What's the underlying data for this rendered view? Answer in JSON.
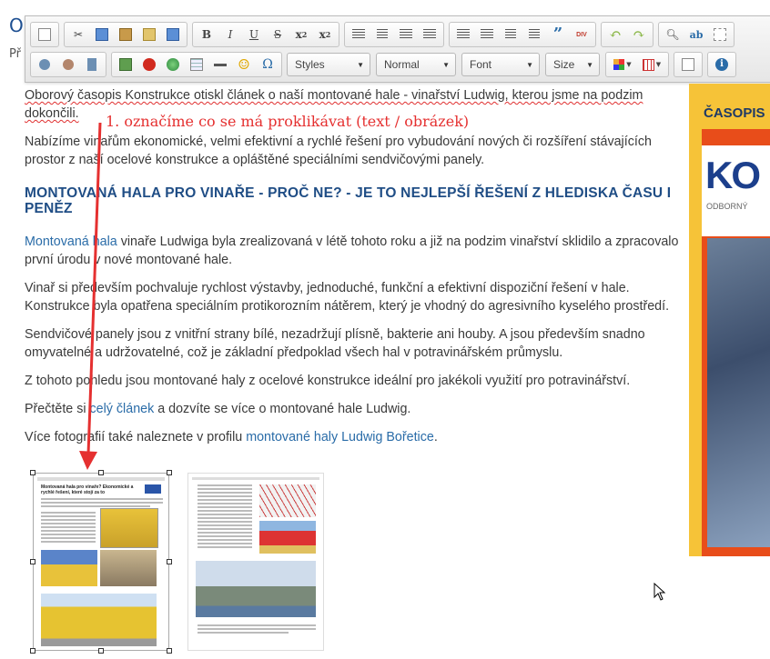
{
  "page": {
    "title_fragment": "O",
    "sub_fragment": "Př"
  },
  "toolbar": {
    "dropdowns": [
      {
        "id": "styles",
        "label": "Styles"
      },
      {
        "id": "format",
        "label": "Normal"
      },
      {
        "id": "font",
        "label": "Font"
      },
      {
        "id": "size",
        "label": "Size"
      }
    ],
    "labels": {
      "bold": "B",
      "italic": "I",
      "underline": "U",
      "strike": "S",
      "subscript": "x",
      "superscript": "x",
      "sub_index": "2",
      "sup_index": "2",
      "quote": "”",
      "div": "DIV",
      "smiley": "☺",
      "omega": "Ω",
      "info": "i"
    }
  },
  "annotation": "1. označíme co se má proklikávat (text / obrázek)",
  "content": {
    "p1": "Oborový časopis Konstrukce otiskl článek o naší montované hale - vinařství Ludwig, kterou jsme na podzim dokončili.",
    "p2": "Nabízíme vinařům ekonomické, velmi efektivní a rychlé řešení pro vybudování nových či rozšíření stávajících prostor z naší ocelové konstrukce a opláštěné speciálními sendvičovými panely.",
    "heading": "MONTOVANÁ HALA PRO VINAŘE - PROČ NE? - JE TO NEJLEPŠÍ ŘEŠENÍ Z HLEDISKA ČASU I PENĚZ",
    "p3_link": "Montovaná hala",
    "p3_rest": " vinaře Ludwiga byla zrealizovaná v létě tohoto roku a již na podzim vinařství sklidilo a zpracovalo první úrodu v nové montované hale.",
    "p4": "Vinař si především pochvaluje rychlost výstavby, jednoduché, funkční a efektivní dispoziční řešení v hale. Konstrukce byla opatřena speciálním protikorozním nátěrem, který je vhodný do agresivního kyselého prostředí.",
    "p5": "Sendvičové panely jsou z vnitřní strany bílé, nezadržují plísně, bakterie ani houby. A jsou především snadno omyvatelné a udržovatelné, což je základní předpoklad všech hal v potravinářském průmyslu.",
    "p6": "Z tohoto pohledu jsou montované haly z ocelové konstrukce ideální pro jakékoli využití pro potravinářství.",
    "p7_pre": "Přečtěte si ",
    "p7_link": "celý článek",
    "p7_post": " a dozvíte se více o montované hale Ludwig.",
    "p8_pre": "Více fotografií také naleznete v profilu ",
    "p8_link1": "montované haly",
    "p8_sep": " ",
    "p8_link2": "Ludwig Bořetice",
    "p8_post": "."
  },
  "thumbnail1": {
    "title": "Montovaná hala pro vinaře? Ekonomické a rychlé řešení, které stojí za to"
  },
  "magazine": {
    "title": "ČASOPIS",
    "logo": "KO",
    "subtitle": "ODBORNÝ"
  }
}
